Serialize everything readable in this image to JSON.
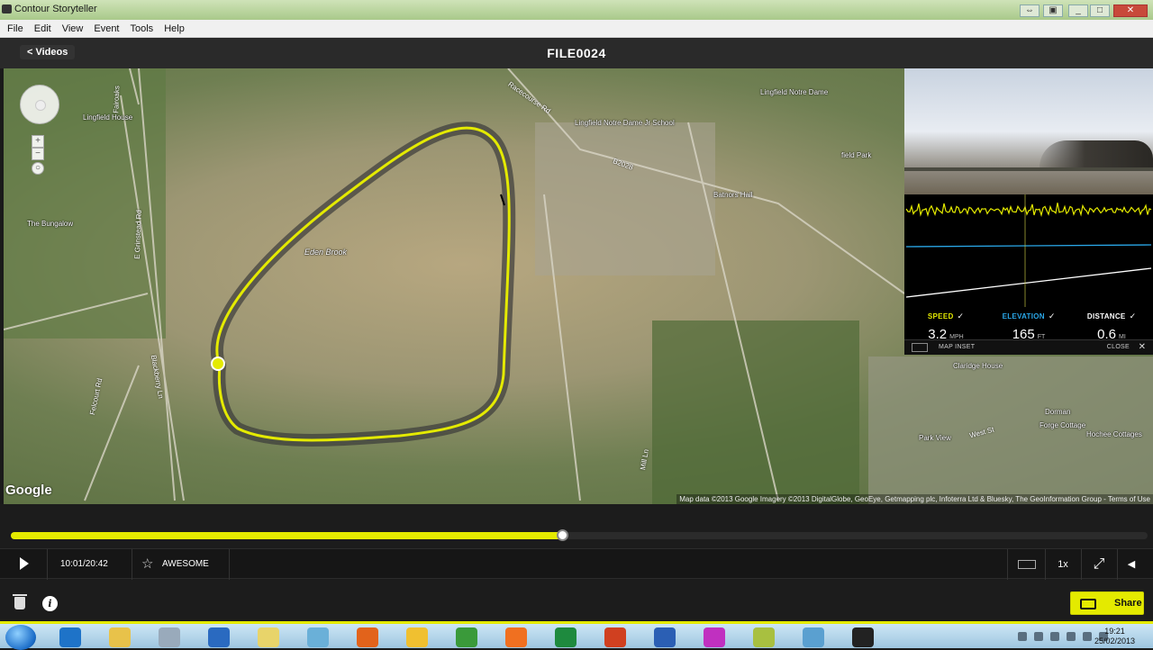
{
  "window": {
    "title": "Contour Storyteller",
    "controls": [
      "_",
      "□",
      "✕"
    ]
  },
  "menu": [
    "File",
    "Edit",
    "View",
    "Event",
    "Tools",
    "Help"
  ],
  "header": {
    "back_label": "< Videos",
    "title": "FILE0024"
  },
  "map": {
    "labels": [
      {
        "text": "Lingfield House"
      },
      {
        "text": "The Bungalow"
      },
      {
        "text": "Lingfield Notre Dame Jr School"
      },
      {
        "text": "Lingfield Notre Dame"
      },
      {
        "text": "Batnors Hall"
      },
      {
        "text": "Eden Brook"
      },
      {
        "text": "field Park"
      },
      {
        "text": "Claridge House"
      },
      {
        "text": "Park View"
      },
      {
        "text": "Dorman"
      },
      {
        "text": "Forge Cottage"
      },
      {
        "text": "Hochee Cottages"
      }
    ],
    "roads": [
      {
        "text": "Racecourse Rd"
      },
      {
        "text": "B2028"
      },
      {
        "text": "E Grinstead Rd"
      },
      {
        "text": "Fairoaks"
      },
      {
        "text": "Felcourt Rd"
      },
      {
        "text": "Blackberry Ln"
      },
      {
        "text": "Mill Ln"
      },
      {
        "text": "West St"
      }
    ],
    "google_logo": "Google",
    "credit": "Map data ©2013 Google Imagery ©2013 DigitalGlobe, GeoEye, Getmapping plc, Infoterra Ltd & Bluesky, The GeoInformation Group - Terms of Use",
    "track_color": "#e4ea00"
  },
  "inset": {
    "stats": [
      {
        "label": "SPEED",
        "value": "3.2",
        "unit": "MPH",
        "color": "#e4ea00"
      },
      {
        "label": "ELEVATION",
        "value": "165",
        "unit": "FT",
        "color": "#2aa7e8"
      },
      {
        "label": "DISTANCE",
        "value": "0.6",
        "unit": "MI",
        "color": "#ffffff"
      }
    ],
    "check": "✓",
    "map_inset_label": "MAP INSET",
    "close_label": "CLOSE",
    "close_icon": "✕"
  },
  "player": {
    "progress": 0.485,
    "time": "10:01/20:42",
    "tag_label": "AWESOME",
    "star_icon": "☆",
    "speed": "1x",
    "fullscreen_icon": "⤢",
    "volume_icon": "◀",
    "share_label": "Share",
    "info_icon": "i"
  },
  "taskbar": {
    "clock_time": "19:21",
    "clock_date": "25/02/2013",
    "icon_colors": [
      "#1e73c8",
      "#e8c24a",
      "#9ab",
      "#2a6ac0",
      "#e8d46a",
      "#6ab0d8",
      "#e2631b",
      "#f0c030",
      "#3a9a3a",
      "#f07020",
      "#1e8a3e",
      "#d04020",
      "#2b5fb4",
      "#c030c0",
      "#a8c040",
      "#5aa0d0",
      "#222"
    ]
  }
}
